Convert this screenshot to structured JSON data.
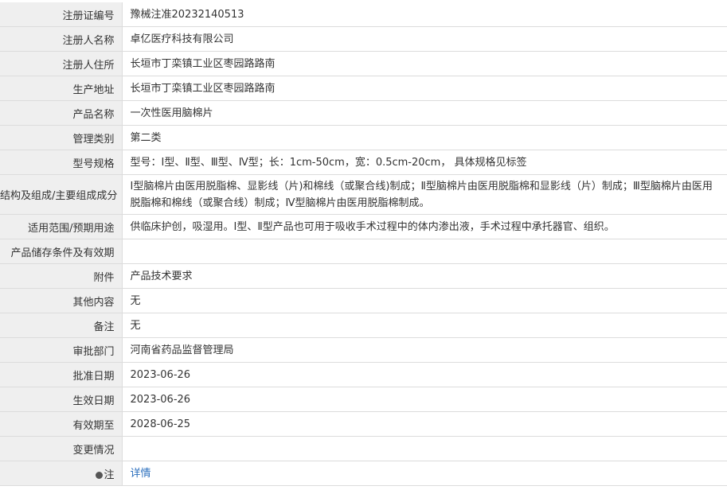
{
  "rows": [
    {
      "label": "注册证编号",
      "value": "豫械注准20232140513"
    },
    {
      "label": "注册人名称",
      "value": "卓亿医疗科技有限公司"
    },
    {
      "label": "注册人住所",
      "value": "长垣市丁栾镇工业区枣园路路南"
    },
    {
      "label": "生产地址",
      "value": "长垣市丁栾镇工业区枣园路路南"
    },
    {
      "label": "产品名称",
      "value": "一次性医用脑棉片"
    },
    {
      "label": "管理类别",
      "value": "第二类"
    },
    {
      "label": "型号规格",
      "value": "型号：Ⅰ型、Ⅱ型、Ⅲ型、Ⅳ型；长：1cm-50cm，宽：0.5cm-20cm， 具体规格见标签"
    },
    {
      "label": "结构及组成/主要组成成分",
      "value": "Ⅰ型脑棉片由医用脱脂棉、显影线（片)和棉线（或聚合线)制成；Ⅱ型脑棉片由医用脱脂棉和显影线（片）制成；Ⅲ型脑棉片由医用脱脂棉和棉线（或聚合线）制成；Ⅳ型脑棉片由医用脱脂棉制成。"
    },
    {
      "label": "适用范围/预期用途",
      "value": "供临床护创，吸湿用。Ⅰ型、Ⅱ型产品也可用于吸收手术过程中的体内渗出液，手术过程中承托器官、组织。"
    },
    {
      "label": "产品储存条件及有效期",
      "value": ""
    },
    {
      "label": "附件",
      "value": "产品技术要求"
    },
    {
      "label": "其他内容",
      "value": "无"
    },
    {
      "label": "备注",
      "value": "无"
    },
    {
      "label": "审批部门",
      "value": "河南省药品监督管理局"
    },
    {
      "label": "批准日期",
      "value": "2023-06-26"
    },
    {
      "label": "生效日期",
      "value": "2023-06-26"
    },
    {
      "label": "有效期至",
      "value": "2028-06-25"
    },
    {
      "label": "变更情况",
      "value": ""
    }
  ],
  "note": {
    "label": "注",
    "link": "详情",
    "icon": "pin-icon"
  }
}
